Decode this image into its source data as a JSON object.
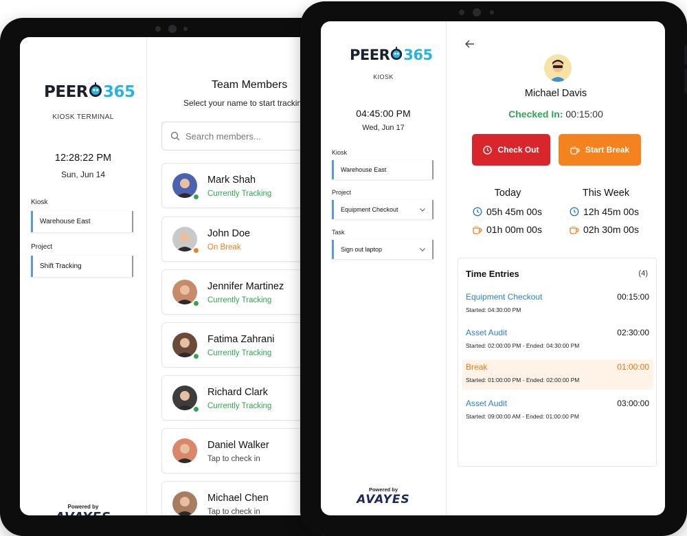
{
  "brand": {
    "logo_a": "PEER",
    "logo_b": "365",
    "powered_by": "Powered by",
    "company": "AVAYES"
  },
  "back_tablet": {
    "kiosk_title": "KIOSK TERMINAL",
    "time": "12:28:22 PM",
    "date": "Sun, Jun 14",
    "kiosk_label": "Kiosk",
    "kiosk_value": "Warehouse East",
    "project_label": "Project",
    "project_value": "Shift Tracking",
    "title": "Team Members",
    "subtitle": "Select your name to start tracking",
    "search_placeholder": "Search members...",
    "members": [
      {
        "name": "Mark Shah",
        "status": "Currently Tracking",
        "state": "tracking"
      },
      {
        "name": "John Doe",
        "status": "On Break",
        "state": "break"
      },
      {
        "name": "Jennifer Martinez",
        "status": "Currently Tracking",
        "state": "tracking"
      },
      {
        "name": "Fatima Zahrani",
        "status": "Currently Tracking",
        "state": "tracking"
      },
      {
        "name": "Richard Clark",
        "status": "Currently Tracking",
        "state": "tracking"
      },
      {
        "name": "Daniel Walker",
        "status": "Tap to check in",
        "state": "idle"
      },
      {
        "name": "Michael Chen",
        "status": "Tap to check in",
        "state": "idle"
      }
    ]
  },
  "front_tablet": {
    "kiosk_title": "KIOSK",
    "time": "04:45:00 PM",
    "date": "Wed, Jun 17",
    "kiosk_label": "Kiosk",
    "kiosk_value": "Warehouse East",
    "project_label": "Project",
    "project_value": "Equipment Checkout",
    "task_label": "Task",
    "task_value": "Sign out laptop",
    "user_name": "Michael Davis",
    "checked_in_label": "Checked In:",
    "checked_in_value": "00:15:00",
    "check_out_label": "Check Out",
    "start_break_label": "Start Break",
    "today_label": "Today",
    "week_label": "This Week",
    "today_work": "05h 45m 00s",
    "today_break": "01h 00m 00s",
    "week_work": "12h 45m 00s",
    "week_break": "02h 30m 00s",
    "entries_title": "Time Entries",
    "entries_count": "(4)",
    "entries": [
      {
        "name": "Equipment Checkout",
        "duration": "00:15:00",
        "detail": "Started: 04:30:00 PM",
        "type": "work"
      },
      {
        "name": "Asset Audit",
        "duration": "02:30:00",
        "detail": "Started: 02:00:00 PM - Ended: 04:30:00 PM",
        "type": "work"
      },
      {
        "name": "Break",
        "duration": "01:00:00",
        "detail": "Started: 01:00:00 PM - Ended: 02:00:00 PM",
        "type": "break"
      },
      {
        "name": "Asset Audit",
        "duration": "03:00:00",
        "detail": "Started: 09:00:00 AM - Ended: 01:00:00 PM",
        "type": "work"
      }
    ]
  },
  "colors": {
    "tracking": "#2ca84e",
    "break": "#f07d1c",
    "idle": "#444444",
    "accent": "#2d7ec9",
    "danger": "#d9262d",
    "warning": "#f4821f",
    "logo_blue": "#2bb3e0"
  }
}
